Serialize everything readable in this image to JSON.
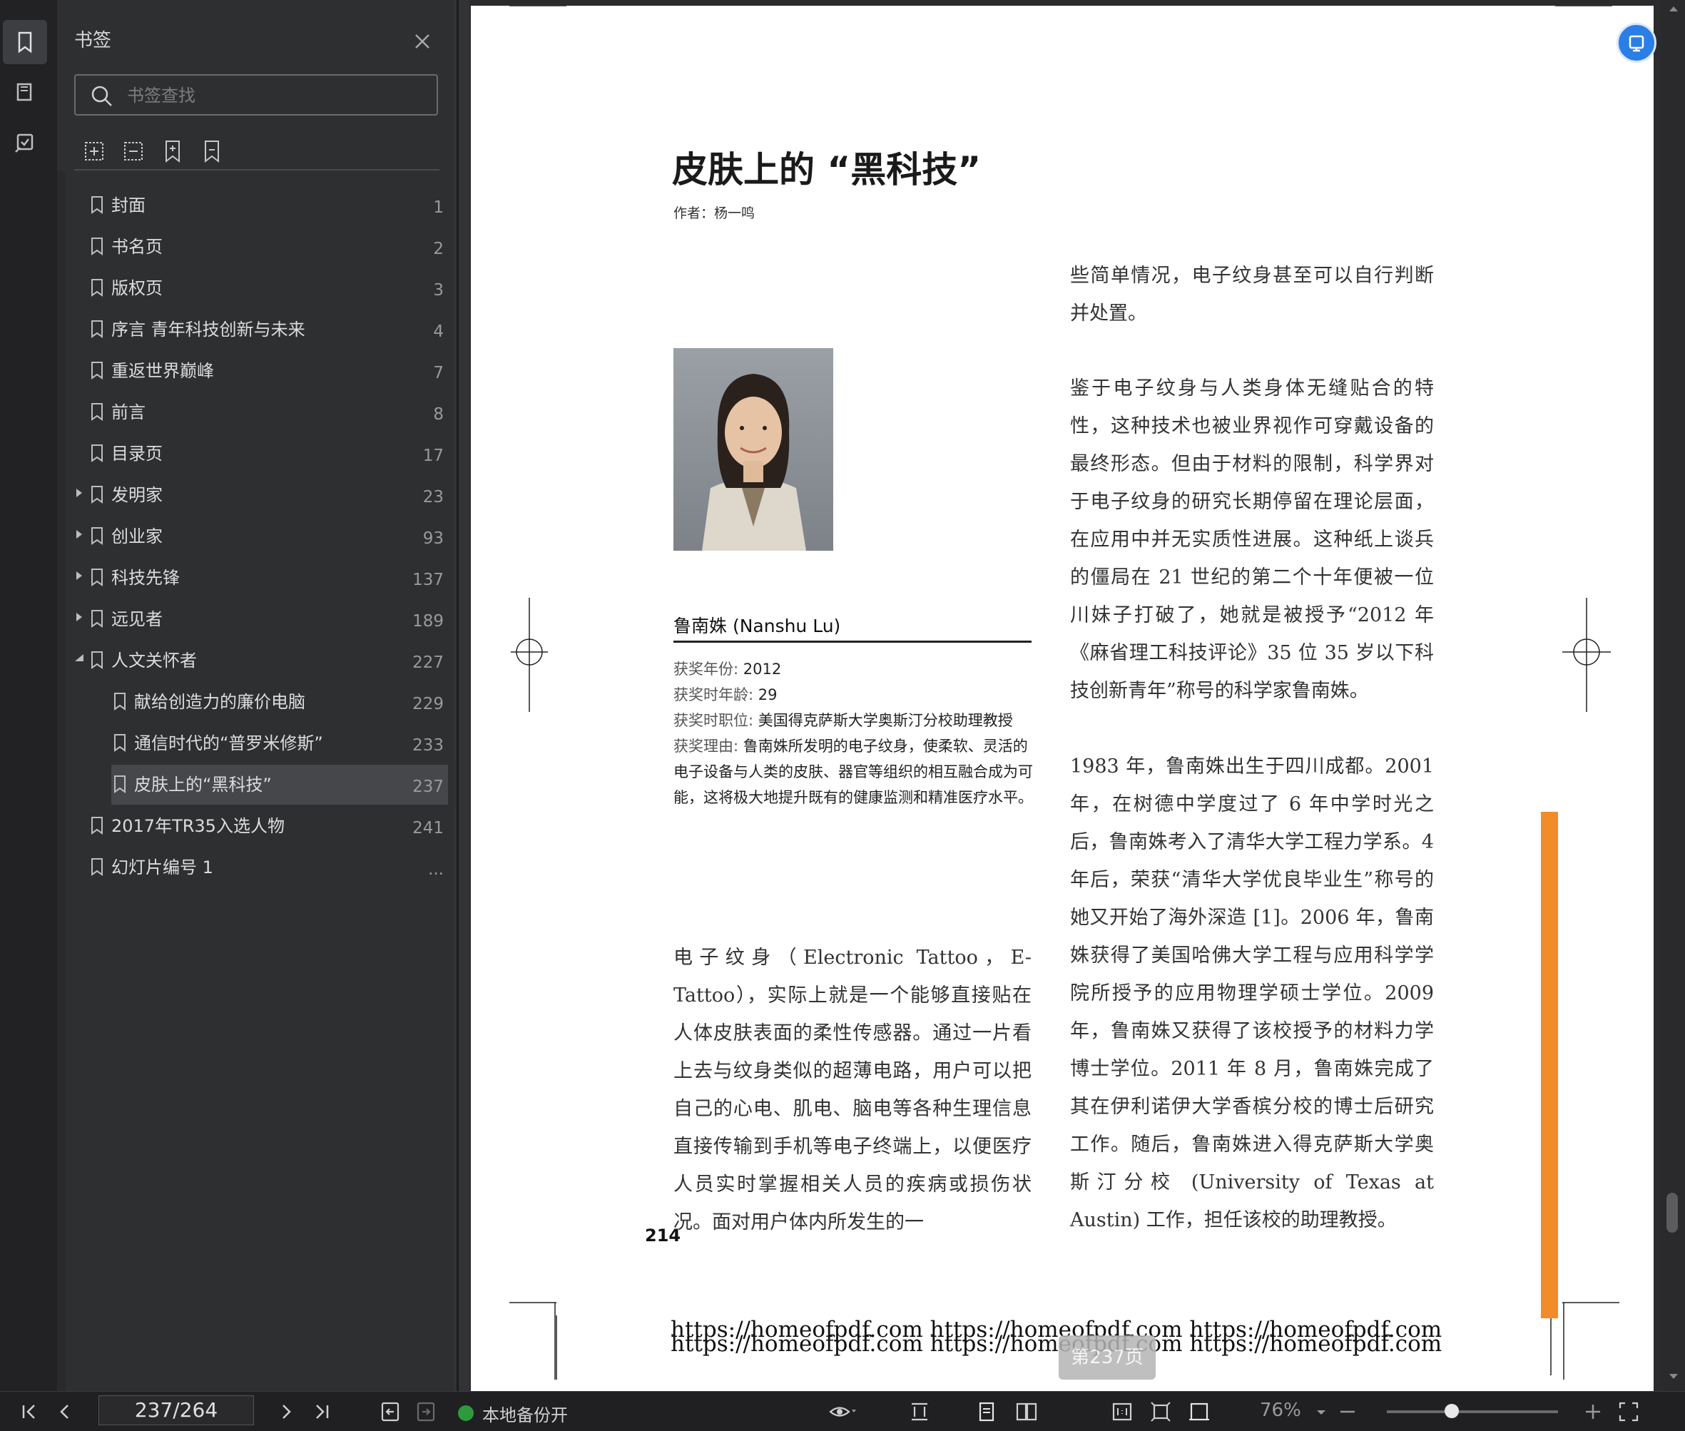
{
  "panel": {
    "title": "书签",
    "search_placeholder": "书签查找",
    "bookmarks": [
      {
        "label": "封面",
        "page": "1"
      },
      {
        "label": "书名页",
        "page": "2"
      },
      {
        "label": "版权页",
        "page": "3"
      },
      {
        "label": "序言  青年科技创新与未来",
        "page": "4"
      },
      {
        "label": "重返世界巅峰",
        "page": "7"
      },
      {
        "label": "前言",
        "page": "8"
      },
      {
        "label": "目录页",
        "page": "17"
      },
      {
        "label": "发明家",
        "page": "23"
      },
      {
        "label": "创业家",
        "page": "93"
      },
      {
        "label": "科技先锋",
        "page": "137"
      },
      {
        "label": "远见者",
        "page": "189"
      },
      {
        "label": "人文关怀者",
        "page": "227"
      },
      {
        "label": "献给创造力的廉价电脑",
        "page": "229"
      },
      {
        "label": "通信时代的“普罗米修斯”",
        "page": "233"
      },
      {
        "label": "皮肤上的“黑科技”",
        "page": "237"
      },
      {
        "label": "2017年TR35入选人物",
        "page": "241"
      },
      {
        "label": "幻灯片编号 1",
        "page": "..."
      }
    ]
  },
  "article": {
    "title": "皮肤上的 “黑科技”",
    "author": "作者：杨一鸣",
    "person_name": "鲁南姝 (Nanshu Lu)",
    "meta": [
      {
        "k": "获奖年份: ",
        "v": "2012"
      },
      {
        "k": "获奖时年龄: ",
        "v": "29"
      },
      {
        "k": "获奖时职位: ",
        "v": "美国得克萨斯大学奥斯汀分校助理教授"
      },
      {
        "k": "获奖理由: ",
        "v": "鲁南姝所发明的电子纹身，使柔软、灵活的电子设备与人类的皮肤、器官等组织的相互融合成为可能，这将极大地提升既有的健康监测和精准医疗水平。"
      }
    ],
    "left_para": "电子纹身（Electronic Tattoo，E-Tattoo），实际上就是一个能够直接贴在人体皮肤表面的柔性传感器。通过一片看上去与纹身类似的超薄电路，用户可以把自己的心电、肌电、脑电等各种生理信息直接传输到手机等电子终端上，以便医疗人员实时掌握相关人员的疾病或损伤状况。面对用户体内所发生的一",
    "right_para_1": "些简单情况，电子纹身甚至可以自行判断并处置。",
    "right_para_2": "鉴于电子纹身与人类身体无缝贴合的特性，这种技术也被业界视作可穿戴设备的最终形态。但由于材料的限制，科学界对于电子纹身的研究长期停留在理论层面，在应用中并无实质性进展。这种纸上谈兵的僵局在 21 世纪的第二个十年便被一位川妹子打破了，她就是被授予“2012 年《麻省理工科技评论》35 位 35 岁以下科技创新青年”称号的科学家鲁南姝。",
    "right_para_3": "1983 年，鲁南姝出生于四川成都。2001 年，在树德中学度过了 6 年中学时光之后，鲁南姝考入了清华大学工程力学系。4 年后，荣获“清华大学优良毕业生”称号的她又开始了海外深造 [1]。2006 年，鲁南姝获得了美国哈佛大学工程与应用科学学院所授予的应用物理学硕士学位。2009 年，鲁南姝又获得了该校授予的材料力学博士学位。2011 年 8 月，鲁南姝完成了其在伊利诺伊大学香槟分校的博士后研究工作。随后，鲁南姝进入得克萨斯大学奥斯汀分校 (University of Texas at Austin) 工作，担任该校的助理教授。",
    "page_number": "214",
    "watermark_1": "https://homeofpdf.com https://homeofpdf.com https://homeofpdf.com",
    "watermark_2": "https://homeofpdf.com https://homeofpdf.com https://homeofpdf.com"
  },
  "viewer": {
    "page_indicator": "第237页",
    "current_page": "237/264",
    "backup_status": "本地备份开",
    "zoom": "76%",
    "zoom_slider_fraction": 0.38
  },
  "icons": {
    "rail": [
      "bookmark-icon",
      "thumbnail-icon",
      "annotation-icon"
    ],
    "accent": "#2a7ee6",
    "highlight_bar": "#f28c28"
  }
}
